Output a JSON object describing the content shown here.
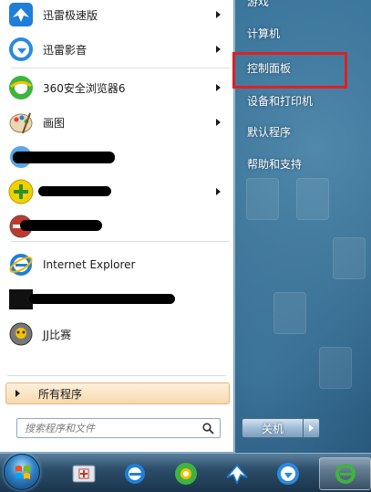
{
  "start_menu": {
    "programs": [
      {
        "label": "迅雷极速版",
        "icon": "thunder-bird-icon",
        "has_submenu": true,
        "redacted": false
      },
      {
        "label": "迅雷影音",
        "icon": "thunder-player-icon",
        "has_submenu": true,
        "redacted": false
      },
      {
        "label": "360安全浏览器6",
        "icon": "360-browser-icon",
        "has_submenu": true,
        "redacted": false
      },
      {
        "label": "画图",
        "icon": "paint-palette-icon",
        "has_submenu": true,
        "redacted": false
      },
      {
        "label": "",
        "icon": "redacted-app-icon",
        "has_submenu": false,
        "redacted": true
      },
      {
        "label": "",
        "icon": "360-guard-icon",
        "has_submenu": true,
        "redacted": true
      },
      {
        "label": "",
        "icon": "redacted-app-icon",
        "has_submenu": false,
        "redacted": true
      },
      {
        "label": "Internet Explorer",
        "icon": "internet-explorer-icon",
        "has_submenu": false,
        "redacted": false
      },
      {
        "label": "",
        "icon": "redacted-app-icon",
        "has_submenu": false,
        "redacted": true
      },
      {
        "label": "JJ比赛",
        "icon": "jj-game-icon",
        "has_submenu": false,
        "redacted": false
      }
    ],
    "all_programs_label": "所有程序",
    "search_placeholder": "搜索程序和文件",
    "right_items": [
      {
        "label": "游戏"
      },
      {
        "label": "计算机"
      },
      {
        "label": "控制面板"
      },
      {
        "label": "设备和打印机"
      },
      {
        "label": "默认程序"
      },
      {
        "label": "帮助和支持"
      }
    ],
    "highlighted_item": "控制面板",
    "highlight_color": "#e02020",
    "shutdown_label": "关机"
  },
  "taskbar": {
    "buttons": [
      {
        "name": "start-orb",
        "icon": "windows-logo-icon"
      },
      {
        "name": "taskbar-app-1",
        "icon": "security-kit-icon"
      },
      {
        "name": "taskbar-app-2",
        "icon": "internet-explorer-icon"
      },
      {
        "name": "taskbar-app-3",
        "icon": "360-speed-icon"
      },
      {
        "name": "taskbar-app-4",
        "icon": "thunder-bird-icon"
      },
      {
        "name": "taskbar-app-5",
        "icon": "thunder-player-icon"
      },
      {
        "name": "taskbar-app-6",
        "icon": "ie-green-icon"
      }
    ]
  },
  "colors": {
    "accent_orange": "#f8d9ad",
    "taskbar": "#2c4d69",
    "menu_white": "#ffffff"
  }
}
